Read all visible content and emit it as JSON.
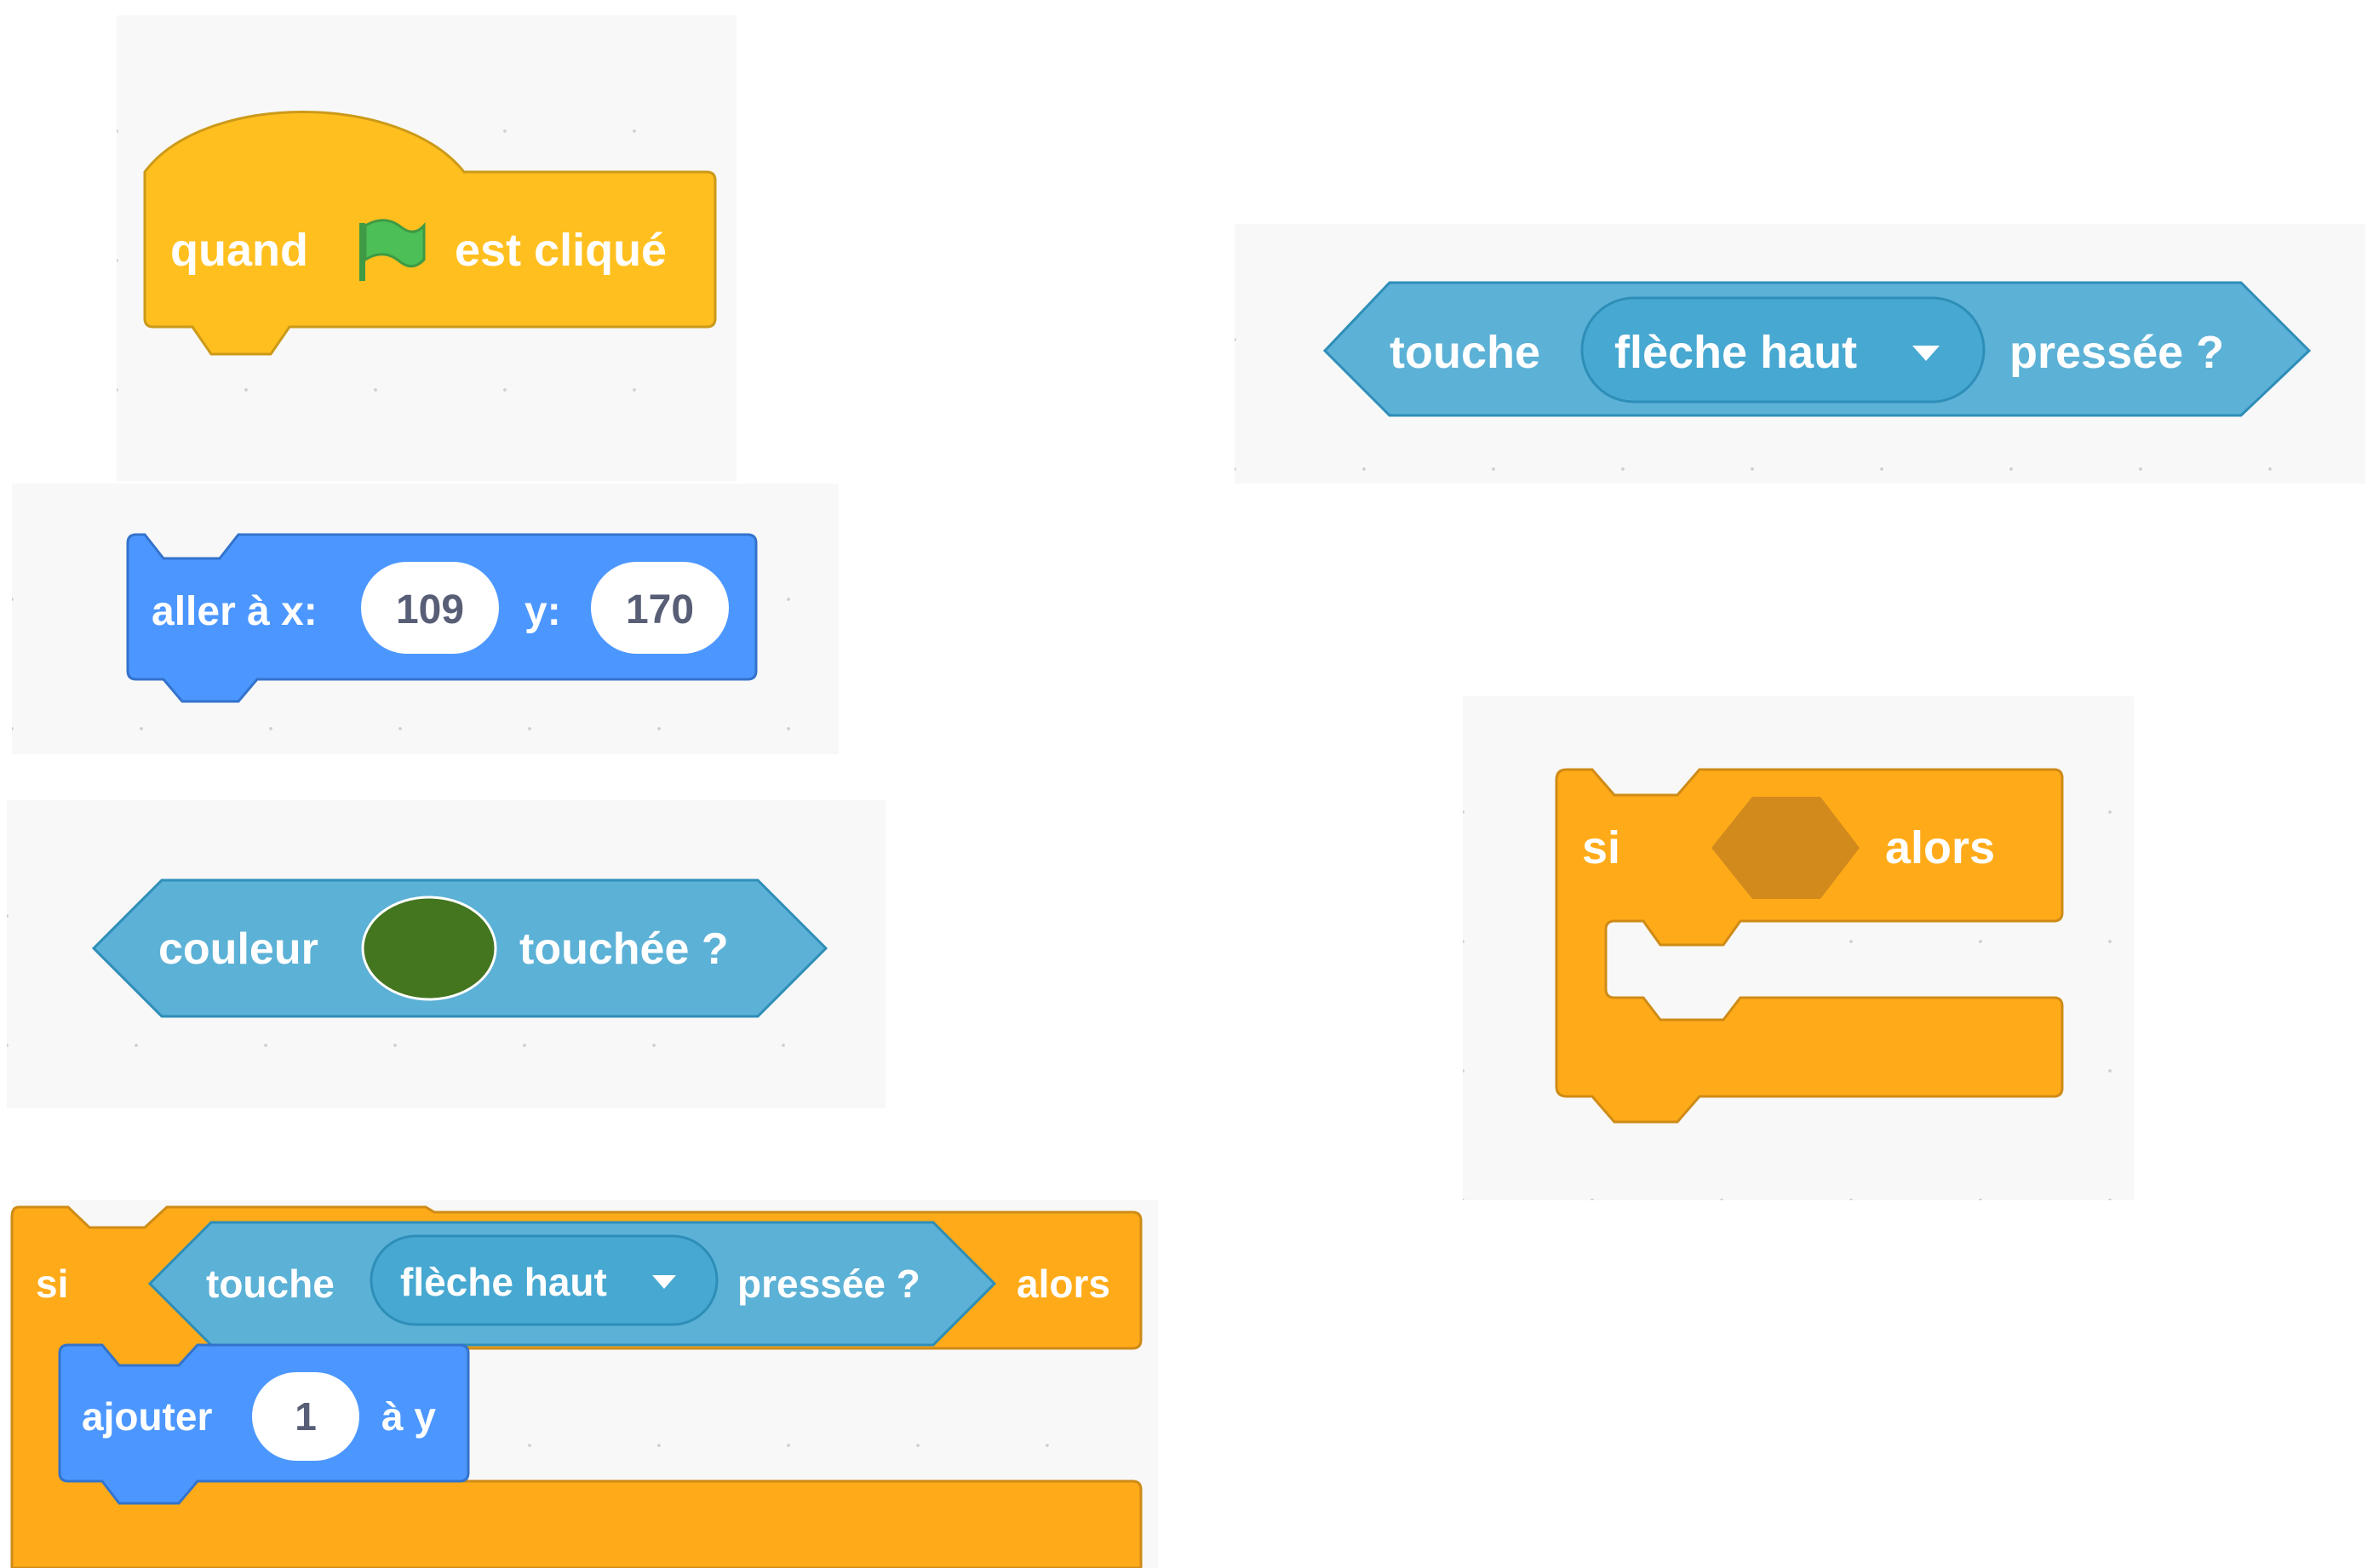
{
  "palette": {
    "events": "#FFBF1F",
    "events_border": "#CC9A19",
    "motion": "#4C97FF",
    "motion_border": "#3373CC",
    "sensing": "#5CB1D6",
    "sensing_border": "#2E8EB8",
    "sensing_dropdown": "#47A8D1",
    "control": "#FFAB19",
    "control_border": "#CF8B17",
    "control_empty_slot": "#D18A1B",
    "flag": "#4CBF56",
    "touch_color": "#44751F",
    "text": "#FFFFFF",
    "input_text": "#575E75",
    "workspace": "#F8F8F8"
  },
  "blocks": {
    "when_flag": {
      "quand": "quand",
      "icon": "green-flag-icon",
      "est_clique": "est cliqué"
    },
    "goto_xy": {
      "label": "aller à x:",
      "x_value": "109",
      "y_label": "y:",
      "y_value": "170"
    },
    "touching_color": {
      "label": "couleur",
      "suffix": "touchée ?"
    },
    "if_key_pressed": {
      "si": "si",
      "touche": "touche",
      "key": "flèche haut",
      "pressee": "pressée ?",
      "alors": "alors",
      "change_label": "ajouter",
      "change_value": "1",
      "change_suffix": "à y"
    },
    "key_pressed": {
      "touche": "touche",
      "key": "flèche haut",
      "pressee": "pressée ?"
    },
    "if_empty": {
      "si": "si",
      "alors": "alors"
    }
  }
}
